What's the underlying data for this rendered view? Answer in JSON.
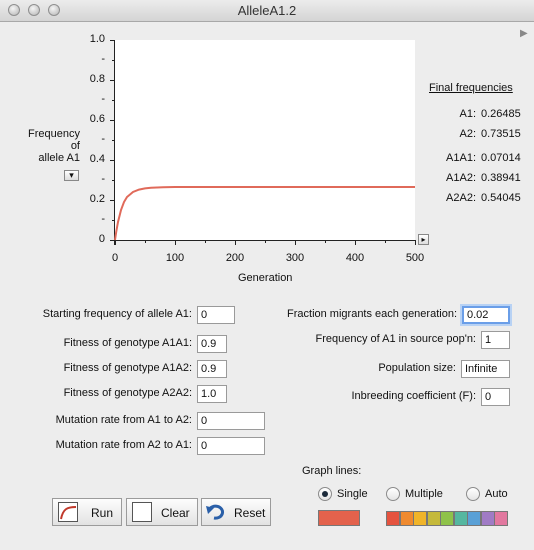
{
  "window": {
    "title": "AlleleA1.2"
  },
  "chart_data": {
    "type": "line",
    "xlim": [
      0,
      500
    ],
    "ylim": [
      0,
      1.0
    ],
    "x_ticks": [
      "0",
      "100",
      "200",
      "300",
      "400",
      "500"
    ],
    "y_ticks": [
      "0",
      "0.2",
      "0.4",
      "0.6",
      "0.8",
      "1.0"
    ],
    "xlabel": "Generation",
    "ylabel": "Frequency of allele A1",
    "series": [
      {
        "color": "#e06a5a",
        "x": [
          0,
          2,
          5,
          10,
          15,
          20,
          30,
          40,
          50,
          60,
          80,
          100,
          150,
          200,
          300,
          400,
          500
        ],
        "y": [
          0,
          0.04,
          0.09,
          0.15,
          0.19,
          0.215,
          0.24,
          0.252,
          0.258,
          0.261,
          0.264,
          0.2648,
          0.2648,
          0.2648,
          0.2648,
          0.2648,
          0.2648
        ]
      }
    ]
  },
  "chart_labels": {
    "ylabel_line1": "Frequency of",
    "ylabel_line2": "allele A1",
    "dropdown": "▾",
    "scroll_arrow": "▸"
  },
  "final": {
    "heading": "Final frequencies",
    "rows": [
      {
        "label": "A1:",
        "value": "0.26485"
      },
      {
        "label": "A2:",
        "value": "0.73515"
      },
      {
        "label": "A1A1:",
        "value": "0.07014"
      },
      {
        "label": "A1A2:",
        "value": "0.38941"
      },
      {
        "label": "A2A2:",
        "value": "0.54045"
      }
    ]
  },
  "params_left": [
    {
      "label": "Starting frequency of allele A1:",
      "value": "0"
    },
    {
      "label": "Fitness of genotype A1A1:",
      "value": "0.9"
    },
    {
      "label": "Fitness of genotype A1A2:",
      "value": "0.9"
    },
    {
      "label": "Fitness of genotype A2A2:",
      "value": "1.0"
    },
    {
      "label": "Mutation rate from A1 to A2:",
      "value": "0"
    },
    {
      "label": "Mutation rate from A2 to A1:",
      "value": "0"
    }
  ],
  "params_right": [
    {
      "label": "Fraction migrants each generation:",
      "value": "0.02"
    },
    {
      "label": "Frequency of A1 in source pop'n:",
      "value": "1"
    },
    {
      "label": "Population size:",
      "value": "Infinite"
    },
    {
      "label": "Inbreeding coefficient (F):",
      "value": "0"
    }
  ],
  "buttons": {
    "run": "Run",
    "clear": "Clear",
    "reset": "Reset"
  },
  "graph_lines": {
    "heading": "Graph lines:",
    "options": [
      "Single",
      "Multiple",
      "Auto"
    ],
    "selected": "Single",
    "single_color": "#e3624c",
    "multi_colors": [
      "#e5533f",
      "#ef8a2f",
      "#f0b429",
      "#c5b93b",
      "#8fc24a",
      "#55b7a0",
      "#5aa0d6",
      "#a07bc5",
      "#e2789f"
    ]
  },
  "colors": {
    "accent": "#6a9ee8",
    "curve": "#e06a5a"
  }
}
